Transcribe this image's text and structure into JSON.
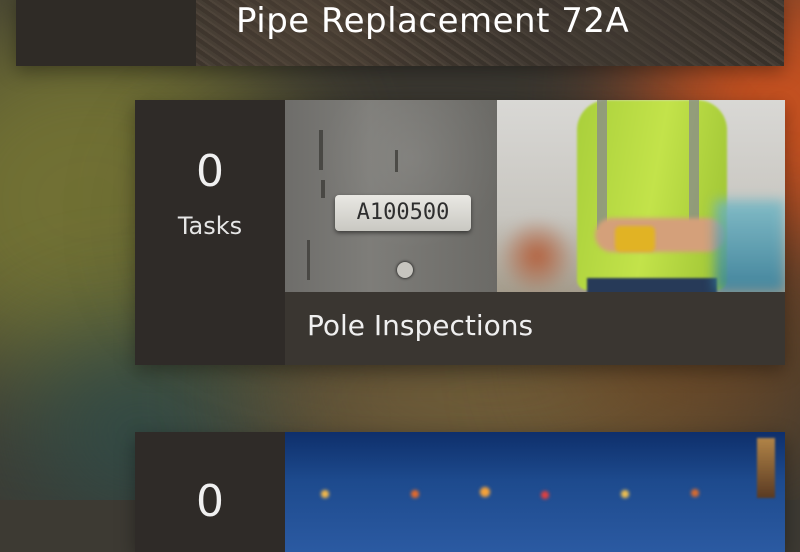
{
  "cards": [
    {
      "title": "Pipe Replacement 72A"
    },
    {
      "count": "0",
      "count_label": "Tasks",
      "title": "Pole Inspections",
      "photo_tag": "A100500"
    },
    {
      "count": "0"
    }
  ]
}
